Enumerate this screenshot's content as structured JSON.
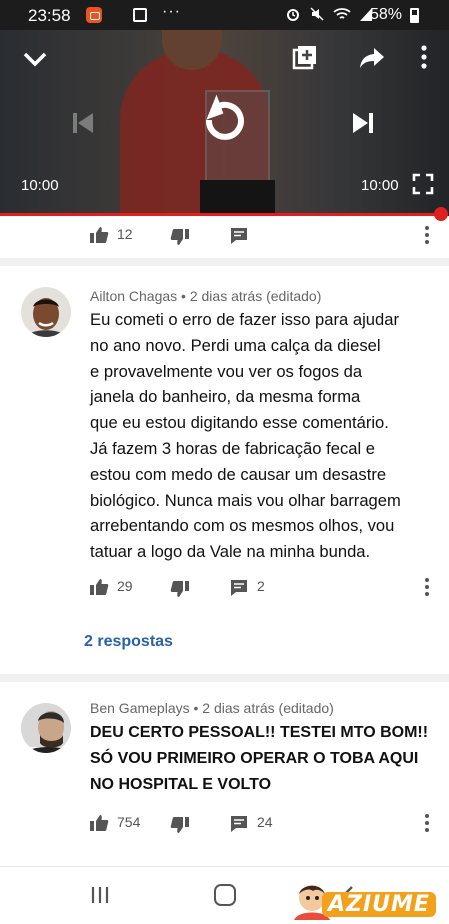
{
  "status_bar": {
    "time": "23:58",
    "battery": "58%",
    "overflow": "···"
  },
  "player": {
    "current_time": "10:00",
    "duration": "10:00",
    "progress": 1.0
  },
  "top_comment_actions": {
    "likes": "12"
  },
  "comments": [
    {
      "author": "Ailton Chagas",
      "meta": "Ailton Chagas • 2 dias atrás (editado)",
      "lines": [
        "Eu cometi o erro de fazer isso para ajudar",
        "no ano novo. Perdi uma calça da diesel",
        "e provavelmente vou ver os fogos da",
        "janela do banheiro, da mesma forma",
        "que eu estou digitando esse comentário.",
        "Já fazem 3 horas de fabricação fecal e",
        "estou com medo de causar um desastre",
        "biológico. Nunca mais vou olhar barragem",
        "arrebentando com os mesmos olhos, vou",
        "tatuar a logo da Vale na minha bunda."
      ],
      "likes": "29",
      "replies": "2",
      "replies_link": "2 respostas"
    },
    {
      "author": "Ben Gameplays",
      "meta": "Ben Gameplays • 2 dias atrás (editado)",
      "lines": [
        "DEU CERTO PESSOAL!! TESTEI MTO BOM!!",
        "SÓ VOU PRIMEIRO OPERAR O TOBA AQUI",
        "NO HOSPITAL E VOLTO"
      ],
      "likes": "754",
      "replies": "24"
    }
  ],
  "watermark": "AZIUME",
  "colors": {
    "accent_red": "#e02020",
    "link_blue": "#2a61a8",
    "watermark_orange": "#f2a11c"
  }
}
